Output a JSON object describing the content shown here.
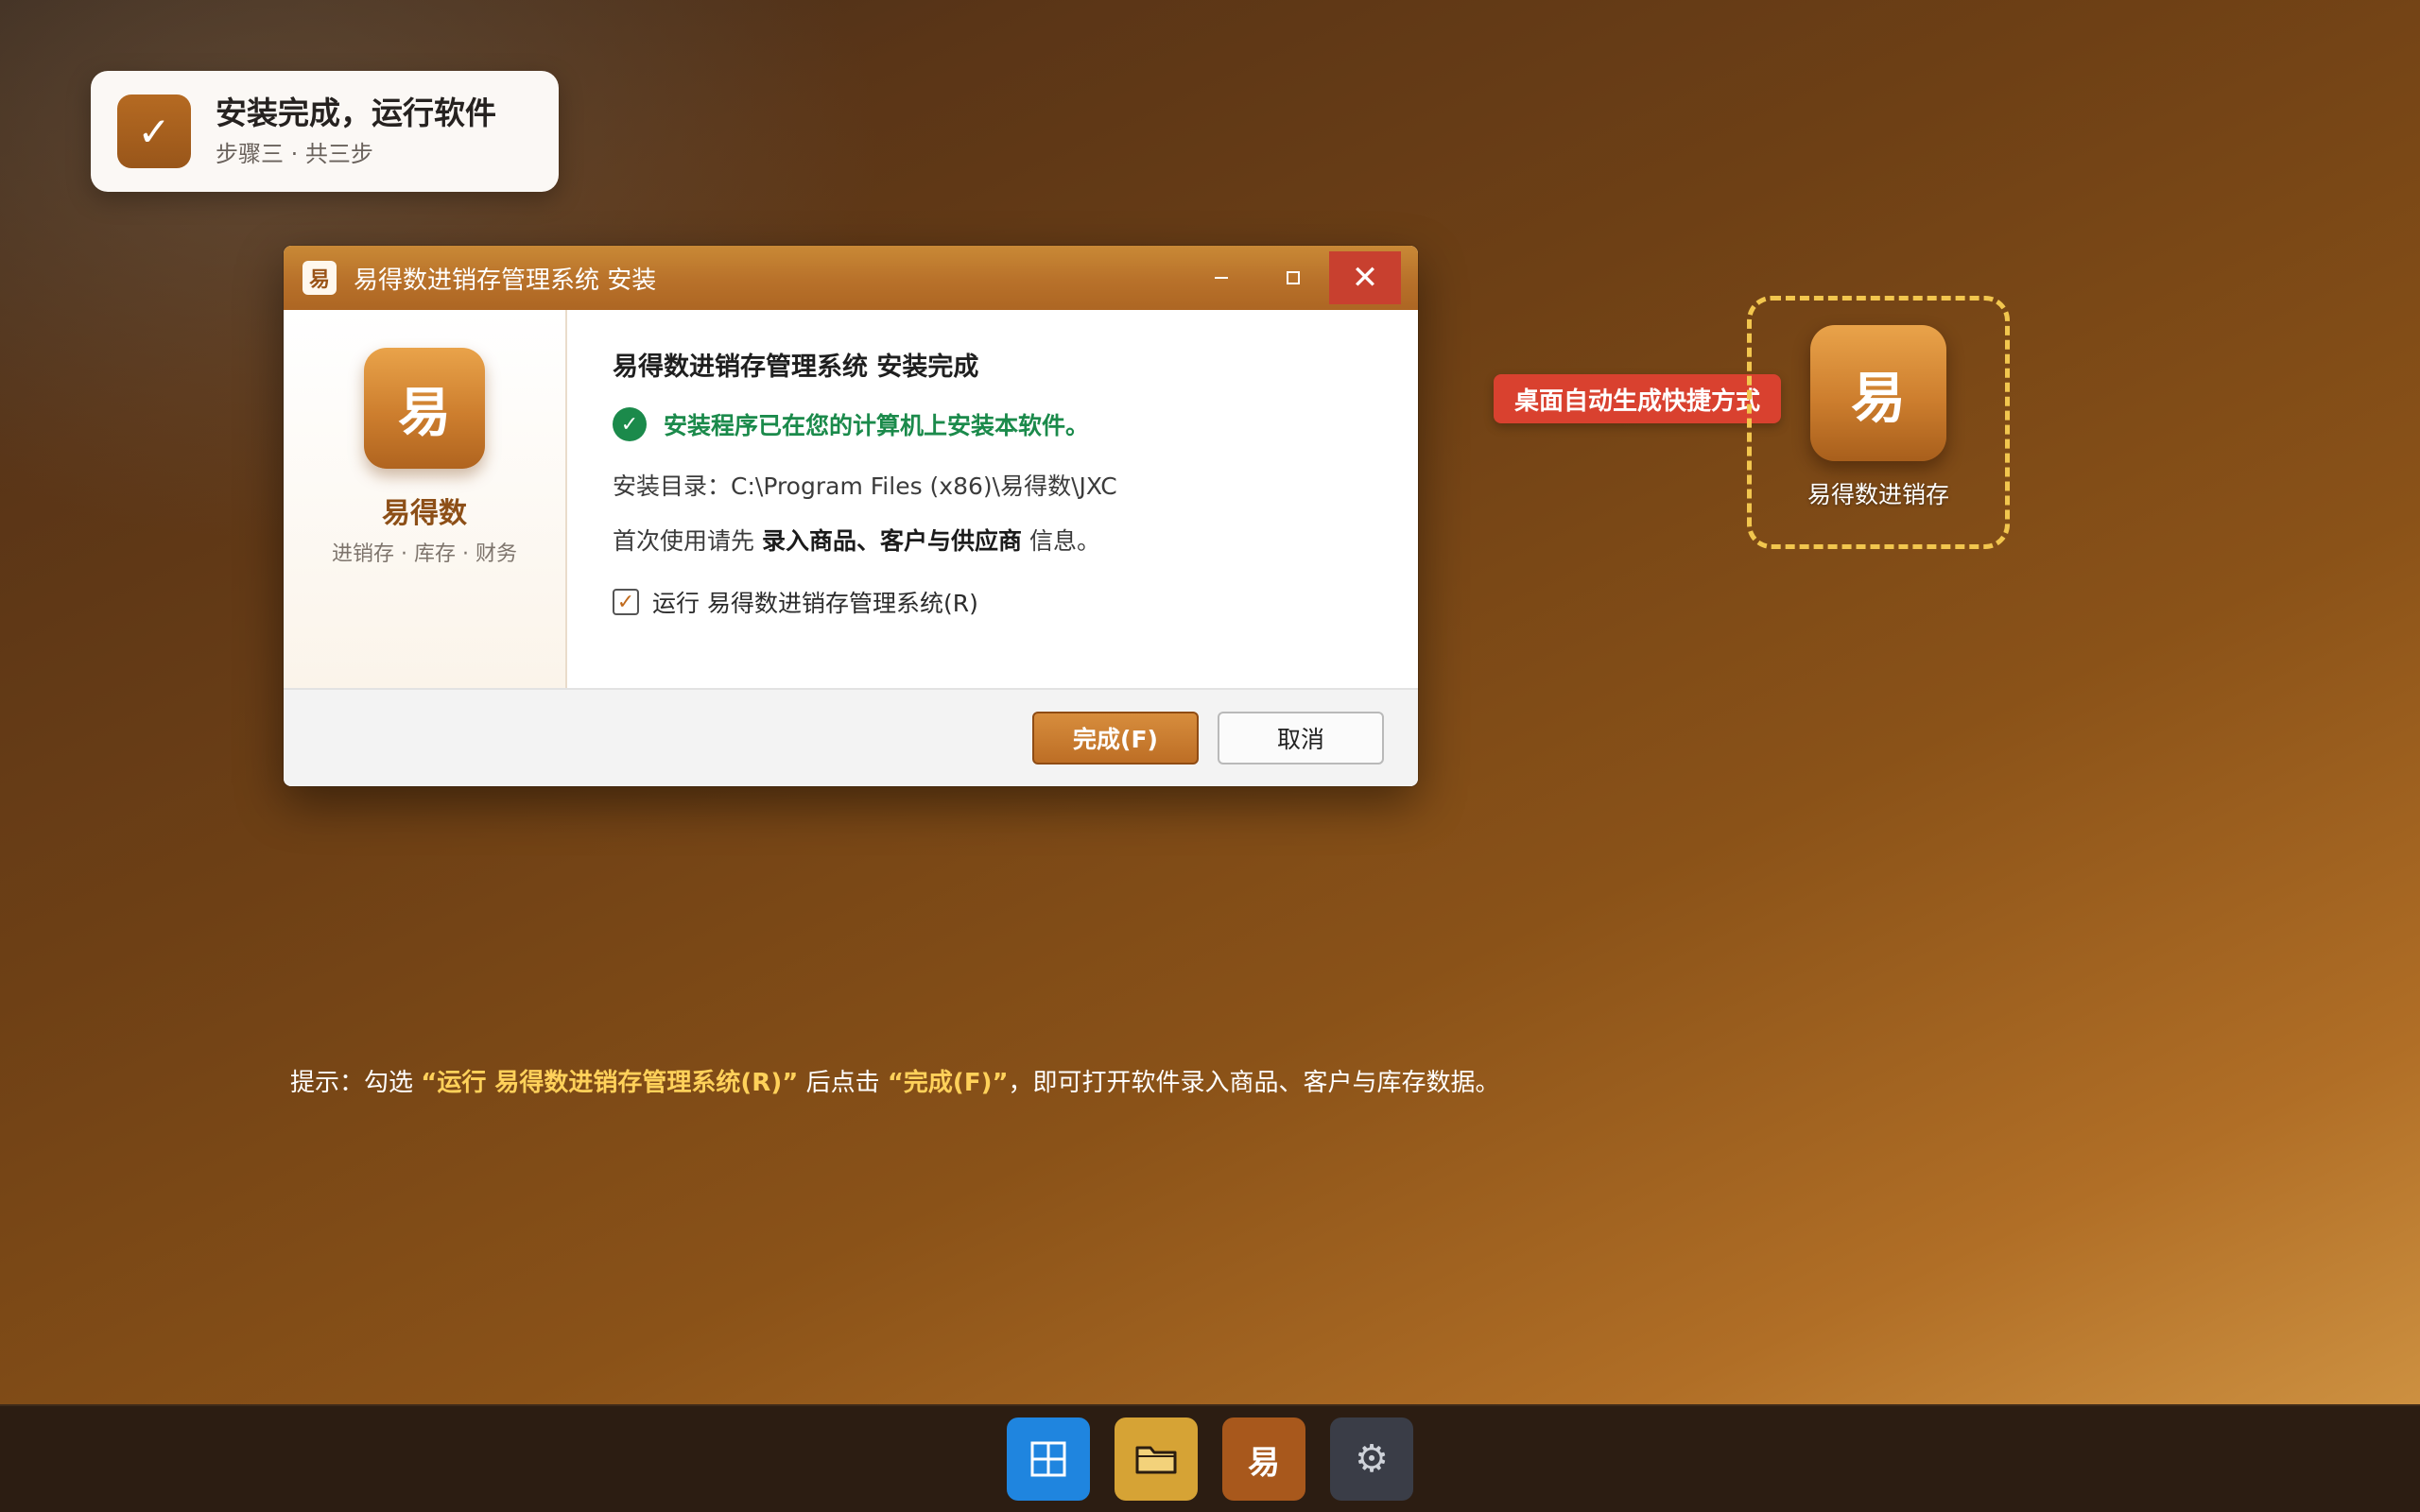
{
  "step_card": {
    "icon": "✓",
    "title": "安装完成，运行软件",
    "subtitle": "步骤三 · 共三步"
  },
  "window": {
    "title": "易得数进销存管理系统 安装",
    "app_icon_char": "易",
    "controls": {
      "close_glyph": "✕"
    },
    "sidebar": {
      "logo_char": "易",
      "name": "易得数",
      "tagline": "进销存 · 库存 · 财务"
    },
    "content": {
      "heading": "易得数进销存管理系统 安装完成",
      "success_message": "安装程序已在您的计算机上安装本软件。",
      "install_dir_label": "安装目录：",
      "install_dir_value": "C:\\Program Files (x86)\\易得数\\JXC",
      "first_use_prefix": "首次使用请先",
      "first_use_bold": "录入商品、客户与供应商",
      "first_use_suffix": "信息。",
      "run_checkbox": {
        "checked": true,
        "mark": "✓",
        "label": "运行 易得数进销存管理系统(R)"
      }
    },
    "buttons": {
      "finish": "完成(F)",
      "cancel": "取消"
    }
  },
  "desktop_shortcut": {
    "callout": "桌面自动生成快捷方式",
    "icon_char": "易",
    "label": "易得数进销存"
  },
  "hint": {
    "prefix": "提示：勾选",
    "highlight1": "“运行 易得数进销存管理系统(R)”",
    "middle": "后点击",
    "highlight2": "“完成(F)”",
    "suffix": "，即可打开软件录入商品、客户与库存数据。"
  },
  "taskbar": {
    "items": [
      {
        "icon": "windows-start-icon"
      },
      {
        "icon": "folder-icon"
      },
      {
        "icon": "yideshu-app-icon",
        "char": "易"
      },
      {
        "icon": "settings-icon",
        "glyph": "⚙"
      }
    ]
  },
  "colors": {
    "accent": "#b8712a",
    "success": "#1b8a4b",
    "callout": "#d9412f",
    "highlight": "#ffd15a"
  }
}
